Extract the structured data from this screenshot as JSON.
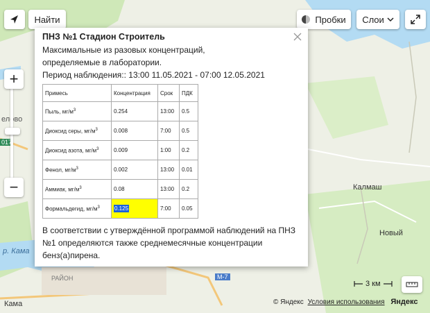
{
  "controls": {
    "find_label": "Найти",
    "traffic_label": "Пробки",
    "layers_label": "Слои"
  },
  "map": {
    "labels": {
      "kama_river": "р. Кама",
      "kama_bottom": "Кама",
      "kalmash": "Калмаш",
      "novyi": "Новый",
      "road_m7": "М-7",
      "district": "РАЙОН",
      "road_badge": "017",
      "side_label": "елово"
    },
    "scale_label": "3 км",
    "copyright": "© Яндекс",
    "terms_label": "Условия использования",
    "logo_text": "Яндекс"
  },
  "popup": {
    "title": "ПНЗ №1 Стадион Строитель",
    "desc1": "Максимальные из разовых концентраций,",
    "desc2": "определяемые в лаборатории.",
    "period": "Период наблюдения:: 13:00 11.05.2021 - 07:00 12.05.2021",
    "table": {
      "headers": [
        "Примесь",
        "Концентрация",
        "Срок",
        "ПДК"
      ],
      "rows": [
        {
          "name": "Пыль, мг/м",
          "sup": "3",
          "value": "0.254",
          "time": "13:00",
          "pdk": "0.5"
        },
        {
          "name": "Диоксид серы, мг/м",
          "sup": "3",
          "value": "0.008",
          "time": "7:00",
          "pdk": "0.5"
        },
        {
          "name": "Диоксид азота, мг/м",
          "sup": "3",
          "value": "0.009",
          "time": "1:00",
          "pdk": "0.2"
        },
        {
          "name": "Фенол, мг/м",
          "sup": "3",
          "value": "0.002",
          "time": "13:00",
          "pdk": "0.01"
        },
        {
          "name": "Аммиак, мг/м",
          "sup": "3",
          "value": "0.08",
          "time": "13:00",
          "pdk": "0.2"
        },
        {
          "name": "Формальдегид, мг/м",
          "sup": "3",
          "value": "0.125",
          "time": "7:00",
          "pdk": "0.05"
        }
      ]
    },
    "footer": "В соответствии с утверждённой программой наблюдений на ПНЗ №1 определяются также среднемесячные концентрации бенз(а)пирена."
  },
  "colors": {
    "highlight": "#ffff00",
    "selection": "#1c62d8",
    "water": "#b3dbf3",
    "forest": "#cfe8b8"
  }
}
